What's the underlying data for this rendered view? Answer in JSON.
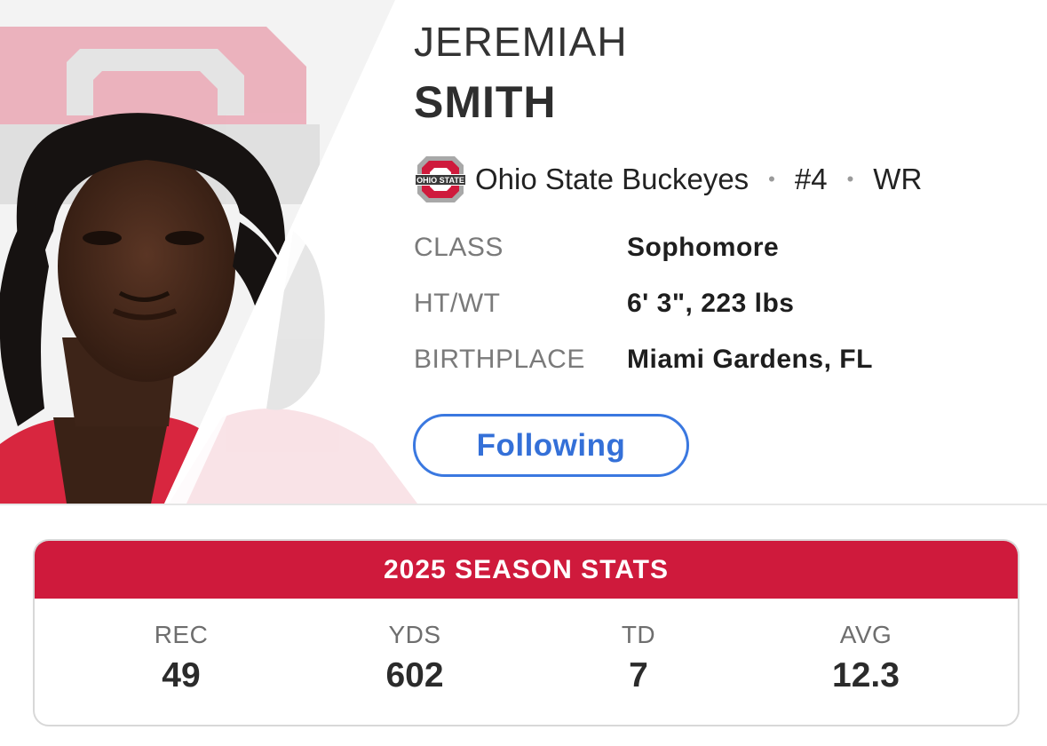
{
  "player": {
    "first_name": "JEREMIAH",
    "last_name": "SMITH",
    "team": "Ohio State Buckeyes",
    "separator": "•",
    "number": "#4",
    "position": "WR",
    "team_logo_text": "OHIO STATE"
  },
  "bio": [
    {
      "label": "CLASS",
      "value": "Sophomore"
    },
    {
      "label": "HT/WT",
      "value": "6' 3\", 223 lbs"
    },
    {
      "label": "BIRTHPLACE",
      "value": "Miami Gardens, FL"
    }
  ],
  "follow_button": {
    "label": "Following"
  },
  "season_stats": {
    "title": "2025 SEASON STATS",
    "stats": [
      {
        "label": "REC",
        "value": "49"
      },
      {
        "label": "YDS",
        "value": "602"
      },
      {
        "label": "TD",
        "value": "7"
      },
      {
        "label": "AVG",
        "value": "12.3"
      }
    ]
  },
  "colors": {
    "team_scarlet": "#cf1a3c",
    "follow_blue": "#3470d8",
    "logo_gray": "#a8a8a8"
  }
}
